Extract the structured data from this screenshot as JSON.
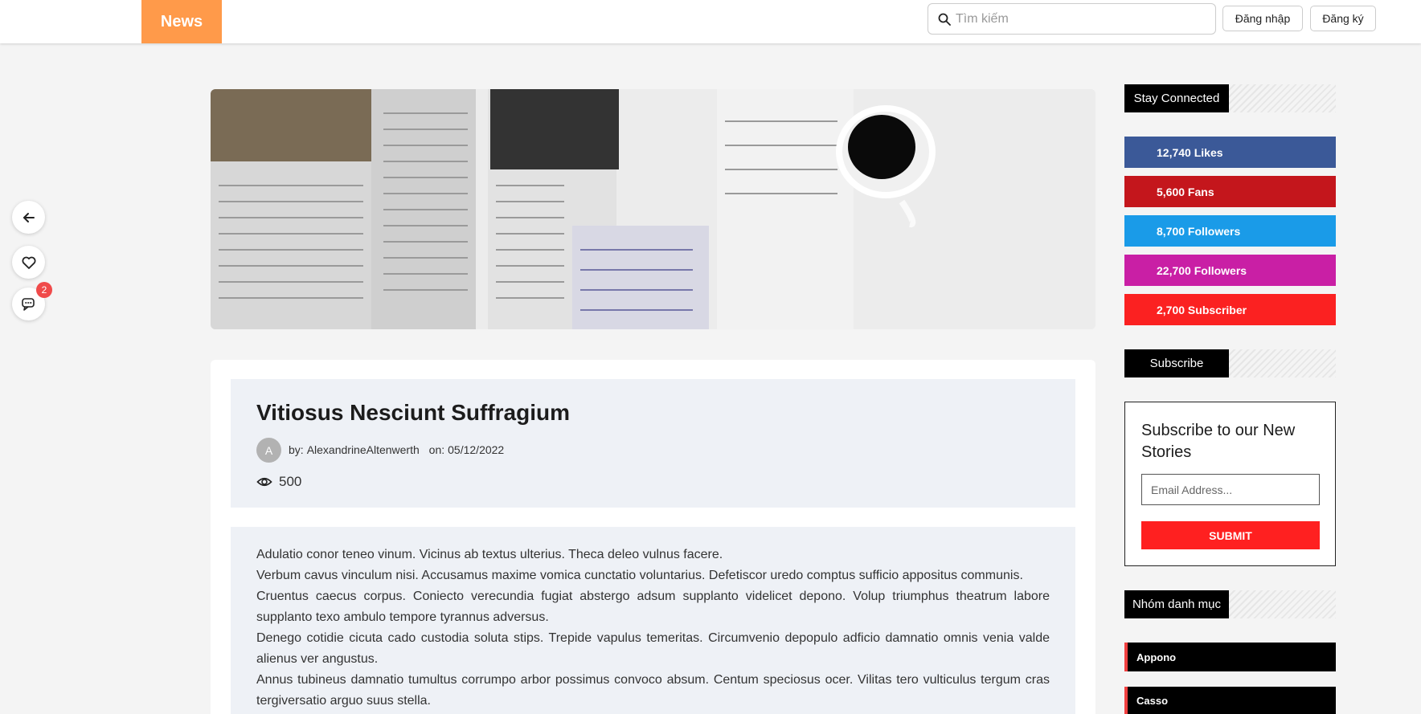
{
  "header": {
    "logo": "News",
    "search_placeholder": "Tìm kiếm",
    "login_label": "Đăng nhập",
    "register_label": "Đăng ký"
  },
  "floating_actions": {
    "back_icon": "arrow-left-icon",
    "like_icon": "heart-icon",
    "comment_icon": "chat-icon",
    "comment_count": "2"
  },
  "hero": {
    "image": "open newspaper with cup of coffee"
  },
  "article": {
    "title": "Vitiosus Nesciunt Suffragium",
    "avatar_letter": "A",
    "author_prefix": "by:",
    "author": "AlexandrineAltenwerth",
    "date_prefix": "on:",
    "date": "05/12/2022",
    "views": "500",
    "paragraphs": [
      "Adulatio conor teneo vinum. Vicinus ab textus ulterius. Theca deleo vulnus facere.",
      "Verbum cavus vinculum nisi. Accusamus maxime vomica cunctatio voluntarius. Defetiscor uredo comptus sufficio appositus communis.",
      "Cruentus caecus corpus. Coniecto verecundia fugiat abstergo adsum supplanto videlicet depono. Volup triumphus theatrum labore supplanto texo ambulo tempore tyrannus adversus.",
      "Denego cotidie cicuta cado custodia soluta stips. Trepide vapulus temeritas. Circumvenio depopulo adficio damnatio omnis venia valde alienus ver angustus.",
      "Annus tubineus damnatio tumultus corrumpo arbor possimus convoco absum. Centum speciosus ocer. Vilitas tero vulticulus tergum cras tergiversatio arguo suus stella."
    ]
  },
  "sidebar": {
    "stay_connected": "Stay Connected",
    "social": [
      {
        "label": "12,740 Likes",
        "color": "#3b5998"
      },
      {
        "label": "5,600 Fans",
        "color": "#c4161c"
      },
      {
        "label": "8,700 Followers",
        "color": "#1a9be8"
      },
      {
        "label": "22,700 Followers",
        "color": "#c91fa5"
      },
      {
        "label": "2,700 Subscriber",
        "color": "#fb2121"
      }
    ],
    "subscribe_heading": "Subscribe",
    "subscribe_box": {
      "title": "Subscribe to our New Stories",
      "email_placeholder": "Email Address...",
      "submit_label": "SUBMIT"
    },
    "categories_heading": "Nhóm danh mục",
    "categories": [
      "Appono",
      "Casso"
    ]
  },
  "colors": {
    "logo_bg": "#ff9a4a",
    "accent_red": "#ff2020",
    "page_bg": "#f4f4f4",
    "panel_bg": "#eef1f6"
  }
}
